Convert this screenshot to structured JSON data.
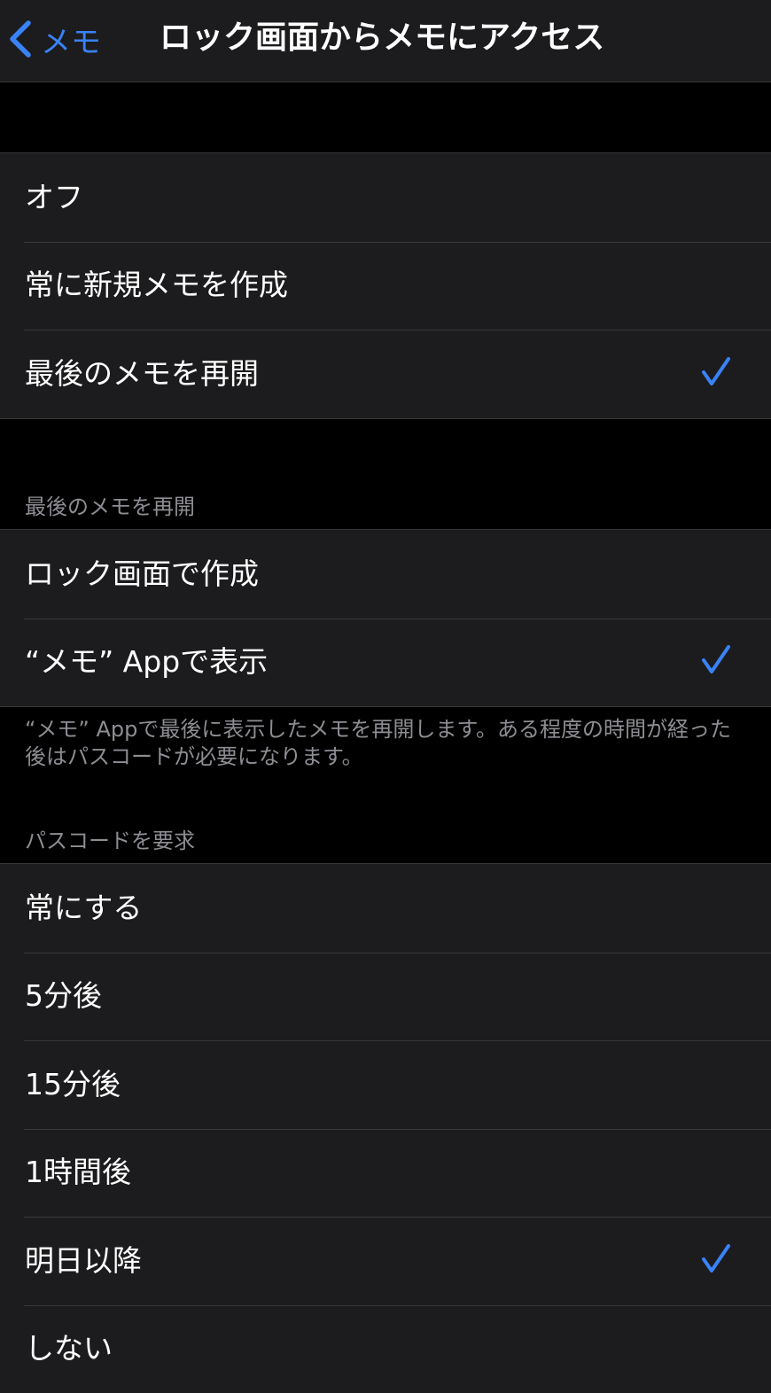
{
  "nav": {
    "back_label": "メモ",
    "title": "ロック画面からメモにアクセス"
  },
  "group_access": {
    "items": [
      {
        "label": "オフ",
        "selected": false
      },
      {
        "label": "常に新規メモを作成",
        "selected": false
      },
      {
        "label": "最後のメモを再開",
        "selected": true
      }
    ]
  },
  "section_resume": {
    "header": "最後のメモを再開",
    "items": [
      {
        "label": "ロック画面で作成",
        "selected": false
      },
      {
        "label": "“メモ” Appで表示",
        "selected": true
      }
    ],
    "footer": "“メモ” Appで最後に表示したメモを再開します。ある程度の時間が経った後はパスコードが必要になります。"
  },
  "section_passcode": {
    "header": "パスコードを要求",
    "items": [
      {
        "label": "常にする",
        "selected": false
      },
      {
        "label": "5分後",
        "selected": false
      },
      {
        "label": "15分後",
        "selected": false
      },
      {
        "label": "1時間後",
        "selected": false
      },
      {
        "label": "明日以降",
        "selected": true
      },
      {
        "label": "しない",
        "selected": false
      }
    ]
  },
  "colors": {
    "accent": "#3a82f7",
    "background": "#000000",
    "cell": "#1c1c1e",
    "separator": "#38383a",
    "secondary_text": "#8d8d93"
  }
}
